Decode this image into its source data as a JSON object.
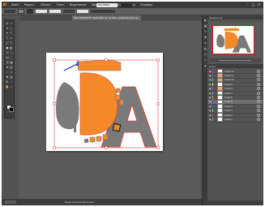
{
  "app": {
    "logo": "Ai",
    "menu": [
      "Файл",
      "Редакт.",
      "Объект",
      "Текст",
      "Выделение",
      "Эффект",
      "Просмотр",
      "Окно",
      "Справка"
    ],
    "workspace": "ОСНОВЫ"
  },
  "document_tab": {
    "title": "ЭКСПЕРИМЕНТ ДИЗАЙН.ai* @ 66% (RGB/Просмотр)"
  },
  "status": {
    "label": "Выделенный фрагмент"
  },
  "panels": {
    "navigator_title": "Навигатор",
    "layers_title": "Слои"
  },
  "layers": [
    {
      "name": "Слой 12",
      "color": "#e23b3b",
      "swatch": "#ffffff",
      "selected": false
    },
    {
      "name": "Слой 11",
      "color": "#3b6ee2",
      "swatch": "#f3a46c",
      "selected": false
    },
    {
      "name": "Слой 10",
      "color": "#3bd15a",
      "swatch": "#f3a46c",
      "selected": false
    },
    {
      "name": "Слой 9",
      "color": "#e2d93b",
      "swatch": "#ffffff",
      "selected": false
    },
    {
      "name": "Слой 8",
      "color": "#c23be2",
      "swatch": "#f3a46c",
      "selected": false
    },
    {
      "name": "Слой 7",
      "color": "#3bd1d1",
      "swatch": "#ffffff",
      "selected": false
    },
    {
      "name": "Слой 6",
      "color": "#e2913b",
      "swatch": "#ffffff",
      "selected": false
    },
    {
      "name": "Слой 5",
      "color": "#8a3be2",
      "swatch": "#ffffff",
      "selected": true
    },
    {
      "name": "Слой 4",
      "color": "#3b6ee2",
      "swatch": "#ffffff",
      "selected": false
    },
    {
      "name": "Слой 3",
      "color": "#3be2a0",
      "swatch": "#ffffff",
      "selected": false
    },
    {
      "name": "Слой 2",
      "color": "#e23b8c",
      "swatch": "#ffffff",
      "selected": false
    },
    {
      "name": "Слой 1",
      "color": "#3bd15a",
      "swatch": "#ffffff",
      "selected": false
    }
  ],
  "colors": {
    "artwork_orange": "#f5892a",
    "artwork_gray": "#7a7a7a",
    "selection_red": "#e43a3a",
    "selection_blue": "#2f56d6"
  }
}
